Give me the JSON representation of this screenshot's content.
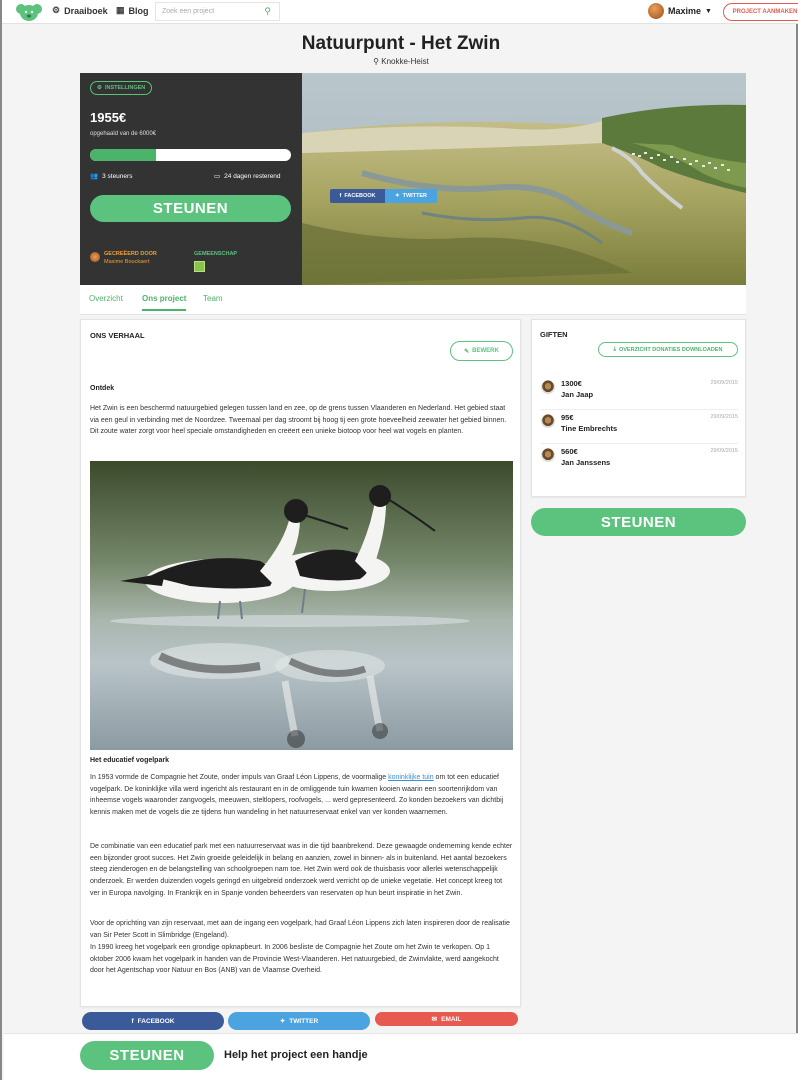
{
  "nav": {
    "links": [
      {
        "label": "Draaiboek",
        "icon": "gears-icon"
      },
      {
        "label": "Blog",
        "icon": "blog-icon"
      }
    ],
    "search_placeholder": "Zoek een project",
    "user_name": "Maxime",
    "create_button": "PROJECT AANMAKEN"
  },
  "project": {
    "title": "Natuurpunt - Het Zwin",
    "location": "Knokke-Heist"
  },
  "funding": {
    "settings_label": "INSTELLINGEN",
    "amount": "1955€",
    "goal_text": "opgehaald van de 6000€",
    "progress_fraction": 0.326,
    "supporters": "3 steuners",
    "days_left": "24 dagen resterend",
    "cta": "STEUNEN",
    "created_by_label": "GECREËERD DOOR",
    "creator_name": "Maxime Bouckaert",
    "community_label": "GEMEENSCHAP"
  },
  "hero_share": {
    "facebook": "FACEBOOK",
    "twitter": "TWITTER"
  },
  "tabs": [
    {
      "label": "Overzicht",
      "active": false
    },
    {
      "label": "Ons project",
      "active": true
    },
    {
      "label": "Team",
      "active": false
    }
  ],
  "story": {
    "heading": "ONS VERHAAL",
    "edit_label": "BEWERK",
    "section1_title": "Ontdek",
    "section1_text": "Het Zwin is een beschermd natuurgebied gelegen tussen land en zee, op de grens tussen Vlaanderen en Nederland.  Het gebied staat via een geul in verbinding met de Noordzee. Tweemaal per dag stroomt bij hoog tij een grote hoeveelheid zeewater het gebied binnen. Dit zoute water zorgt voor heel speciale omstandigheden en creëert een unieke biotoop voor heel wat vogels en planten.",
    "section2_title": "Het educatief vogelpark",
    "section2_text_a": "In 1953 vormde de Compagnie het Zoute, onder impuls van Graaf Léon Lippens, de voormalige ",
    "section2_link": "koninklijke tuin",
    "section2_text_b": " om tot een educatief vogelpark. De koninklijke villa werd ingericht als restaurant en in de omliggende tuin kwamen kooien waarin een soortenrijkdom van inheemse vogels  waaronder zangvogels, meeuwen, steltlopers, roofvogels, ... werd gepresenteerd. Zo konden bezoekers van dichtbij kennis maken met de vogels die ze tijdens hun wandeling in het natuurreservaat enkel van ver konden waarnemen.",
    "section3_text": "De combinatie van een educatief park met een natuurreservaat was in die tijd baanbrekend. Deze gewaagde onderneming kende echter een bijzonder groot succes. Het Zwin groeide geleidelijk in belang en aanzien, zowel in binnen- als in buitenland. Het aantal bezoekers steeg zienderogen en de belangstelling van schoolgroepen nam toe. Het Zwin werd ook de thuisbasis voor allerlei wetenschappelijk onderzoek. Er werden duizenden vogels geringd en uitgebreid onderzoek werd verricht op de unieke vegetatie. Het concept kreeg tot ver in Europa navolging. In Frankrijk en in Spanje vonden beheerders van reservaten op hun beurt inspiratie in het Zwin.",
    "section4_text": "Voor de oprichting van zijn reservaat, met aan de ingang  een vogelpark,  had Graaf Léon Lippens zich laten inspireren door de realisatie van Sir Peter Scott in Slimbridge (Engeland).",
    "section5_text": "In 1990 kreeg het vogelpark een grondige opknapbeurt. In 2006 besliste de Compagnie het Zoute om het Zwin te verkopen. Op 1 oktober 2006 kwam het vogelpark in handen van de Provincie West-Vlaanderen. Het natuurgebied, de Zwinvlakte, werd aangekocht door het Agentschap voor Natuur en Bos (ANB) van de Vlaamse Overheid."
  },
  "gifts": {
    "heading": "GIFTEN",
    "download_label": "OVERZICHT DONATIES DOWNLOADEN",
    "items": [
      {
        "amount": "1300€",
        "name": "Jan Jaap",
        "date": "29/09/2015"
      },
      {
        "amount": "95€",
        "name": "Tine Embrechts",
        "date": "29/09/2015"
      },
      {
        "amount": "560€",
        "name": "Jan Janssens",
        "date": "29/09/2015"
      }
    ],
    "cta": "STEUNEN"
  },
  "share_bottom": {
    "facebook": "FACEBOOK",
    "twitter": "TWITTER",
    "email": "EMAIL"
  },
  "footer": {
    "cta": "STEUNEN",
    "text": "Help het project een handje"
  },
  "colors": {
    "accent": "#5cc37e",
    "facebook": "#3b5a9a",
    "twitter": "#4ba3e0",
    "email": "#e85a4f",
    "dark_panel": "#333333"
  }
}
